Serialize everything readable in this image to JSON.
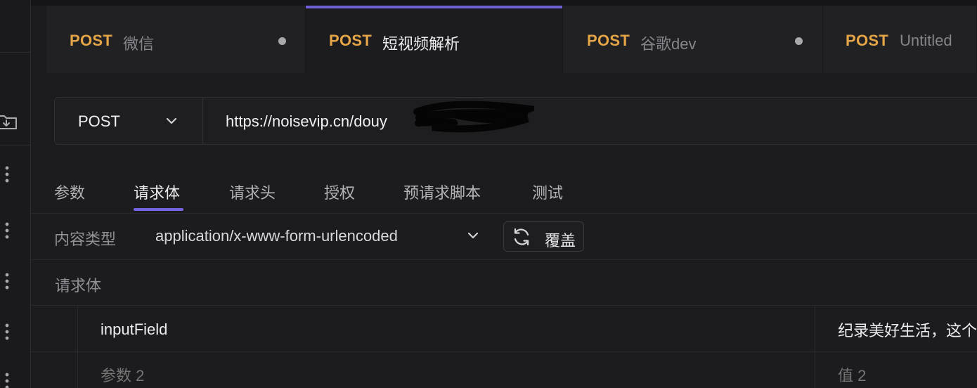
{
  "tabs": [
    {
      "method": "POST",
      "name": "微信",
      "unsaved": true,
      "active": false
    },
    {
      "method": "POST",
      "name": "短视频解析",
      "unsaved": false,
      "active": true
    },
    {
      "method": "POST",
      "name": "谷歌dev",
      "unsaved": true,
      "active": false
    },
    {
      "method": "POST",
      "name": "Untitled",
      "unsaved": false,
      "active": false
    }
  ],
  "request": {
    "method": "POST",
    "url": "https://noisevip.cn/douy"
  },
  "subtabs": [
    "参数",
    "请求体",
    "请求头",
    "授权",
    "预请求脚本",
    "测试"
  ],
  "active_subtab": "请求体",
  "content_type": {
    "label": "内容类型",
    "value": "application/x-www-form-urlencoded",
    "override_label": "覆盖"
  },
  "body": {
    "label": "请求体",
    "rows": [
      {
        "key": "inputField",
        "value": "纪录美好生活，这个"
      },
      {
        "key_placeholder": "参数 2",
        "value_placeholder": "值 2"
      }
    ]
  },
  "icons": {
    "rail": [
      "folder-download-icon",
      "more-vertical-icon",
      "more-vertical-icon",
      "more-vertical-icon",
      "more-vertical-icon",
      "more-vertical-icon"
    ],
    "method_dropdown": "chevron-down-icon",
    "content_type_dropdown": "chevron-down-icon",
    "override": "refresh-icon"
  },
  "colors": {
    "accent": "#7464e0",
    "method": "#e6a546",
    "background": "#1c1c1f"
  }
}
